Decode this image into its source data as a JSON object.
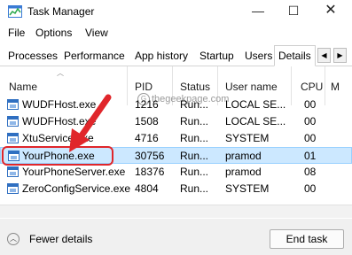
{
  "window": {
    "title": "Task Manager",
    "minimize_glyph": "—",
    "maximize_glyph": "☐",
    "close_glyph": "✕"
  },
  "menu": [
    "File",
    "Options",
    "View"
  ],
  "tabs": [
    {
      "label": "Processes",
      "selected": false
    },
    {
      "label": "Performance",
      "selected": false
    },
    {
      "label": "App history",
      "selected": false
    },
    {
      "label": "Startup",
      "selected": false
    },
    {
      "label": "Users",
      "selected": false
    },
    {
      "label": "Details",
      "selected": true
    }
  ],
  "tab_scroll": {
    "left": "◀",
    "right": "▶"
  },
  "table": {
    "columns": [
      "Name",
      "PID",
      "Status",
      "User name",
      "CPU",
      "M"
    ],
    "rows": [
      {
        "name": "WUDFHost.exe",
        "pid": "1216",
        "status": "Run...",
        "user": "LOCAL SE...",
        "cpu": "00",
        "selected": false
      },
      {
        "name": "WUDFHost.exe",
        "pid": "1508",
        "status": "Run...",
        "user": "LOCAL SE...",
        "cpu": "00",
        "selected": false
      },
      {
        "name": "XtuService.exe",
        "pid": "4716",
        "status": "Run...",
        "user": "SYSTEM",
        "cpu": "00",
        "selected": false
      },
      {
        "name": "YourPhone.exe",
        "pid": "30756",
        "status": "Run...",
        "user": "pramod",
        "cpu": "01",
        "selected": true
      },
      {
        "name": "YourPhoneServer.exe",
        "pid": "18376",
        "status": "Run...",
        "user": "pramod",
        "cpu": "08",
        "selected": false
      },
      {
        "name": "ZeroConfigService.exe",
        "pid": "4804",
        "status": "Run...",
        "user": "SYSTEM",
        "cpu": "00",
        "selected": false
      }
    ]
  },
  "watermark": {
    "text": "thegeekpage.com",
    "glyph": "G"
  },
  "footer": {
    "fewer_details": "Fewer details",
    "fewer_glyph": "︿",
    "end_task": "End task"
  },
  "annotation_color": "#e0262b",
  "selection_color": "#cce8ff"
}
